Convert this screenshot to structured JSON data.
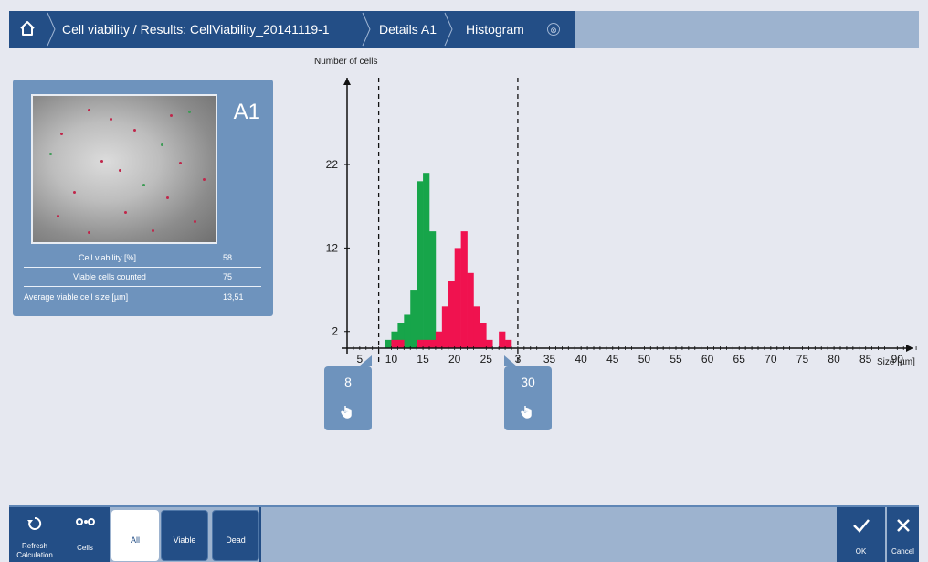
{
  "breadcrumb": {
    "items": [
      "Cell viability / Results: CellViability_20141119-1",
      "Details A1",
      "Histogram"
    ],
    "close_symbol": "⊗"
  },
  "well_card": {
    "well_id": "A1",
    "stats": [
      {
        "label": "Cell viability [%]",
        "value": "58"
      },
      {
        "label": "Viable cells counted",
        "value": "75"
      },
      {
        "label": "Average viable cell size [µm]",
        "value": "13,51"
      }
    ]
  },
  "handles": {
    "min": {
      "value": "8"
    },
    "max": {
      "value": "30"
    }
  },
  "toolbar": {
    "refresh_label_1": "Refresh",
    "refresh_label_2": "Calculation",
    "cells_label": "Cells",
    "filter_all": "All",
    "filter_viable": "Viable",
    "filter_dead": "Dead",
    "ok_label": "OK",
    "cancel_label": "Cancel"
  },
  "colors": {
    "viable": "#17a54a",
    "dead": "#f0124f",
    "accent": "#234e86"
  },
  "chart_data": {
    "type": "bar",
    "ylabel": "Number of cells",
    "xlabel": "Size [µm]",
    "x_ticks": [
      "5",
      "10",
      "15",
      "20",
      "25",
      "3",
      "35",
      "40",
      "45",
      "50",
      "55",
      "60",
      "65",
      "70",
      "75",
      "80",
      "85",
      "90"
    ],
    "y_ticks": [
      "2",
      "12",
      "22"
    ],
    "xlim": [
      3,
      94
    ],
    "ylim": [
      0,
      30
    ],
    "gate_min": 8,
    "gate_max": 30,
    "bin_width": 1,
    "series": [
      {
        "color": "#17a54a",
        "bins": [
          [
            9,
            1
          ],
          [
            10,
            2
          ],
          [
            11,
            3
          ],
          [
            12,
            4
          ],
          [
            13,
            7
          ],
          [
            14,
            20
          ],
          [
            15,
            21
          ],
          [
            16,
            14
          ]
        ]
      },
      {
        "color": "#f0124f",
        "bins": [
          [
            10,
            1
          ],
          [
            11,
            1
          ],
          [
            12,
            0
          ],
          [
            13,
            0
          ],
          [
            14,
            1
          ],
          [
            15,
            1
          ],
          [
            16,
            1
          ],
          [
            17,
            2
          ],
          [
            18,
            5
          ],
          [
            19,
            8
          ],
          [
            20,
            12
          ],
          [
            21,
            14
          ],
          [
            22,
            9
          ],
          [
            23,
            5
          ],
          [
            24,
            3
          ],
          [
            25,
            1
          ],
          [
            26,
            0
          ],
          [
            27,
            2
          ],
          [
            28,
            1
          ]
        ]
      }
    ]
  }
}
